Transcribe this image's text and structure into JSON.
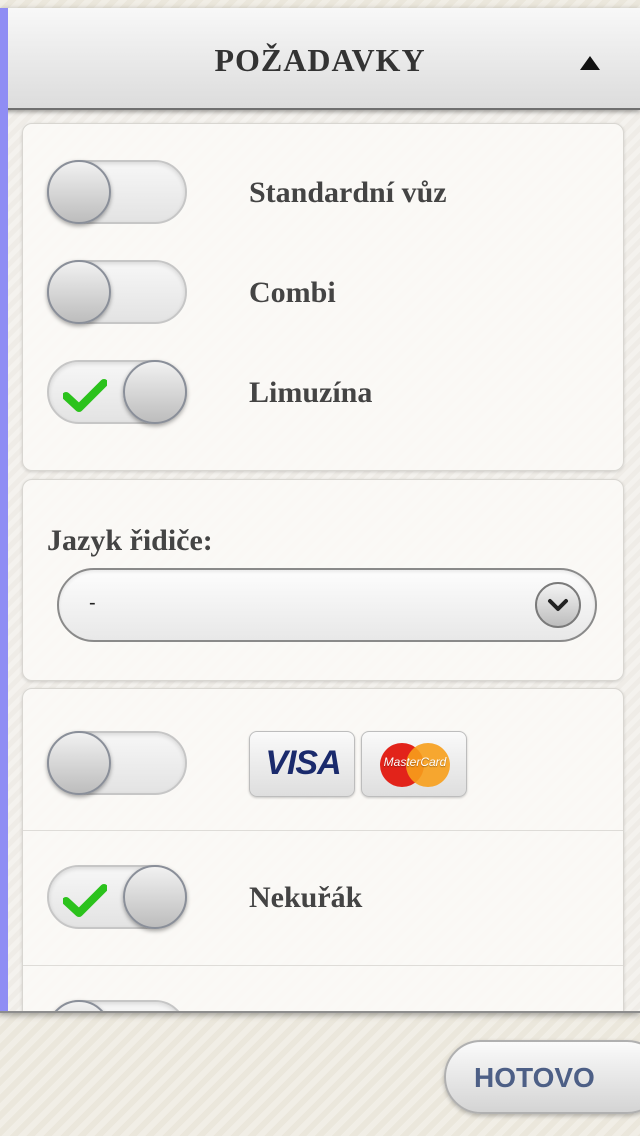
{
  "header": {
    "title": "POŽADAVKY",
    "collapse_icon": "triangle-up-icon"
  },
  "vehicle_types": [
    {
      "label": "Standardní vůz",
      "checked": false
    },
    {
      "label": "Combi",
      "checked": false
    },
    {
      "label": "Limuzína",
      "checked": true
    }
  ],
  "driver_language": {
    "label": "Jazyk řidiče:",
    "selected": "-",
    "dropdown_icon": "chevron-down-icon"
  },
  "options": {
    "card_payment": {
      "checked": false,
      "visa_label": "VISA",
      "mastercard_label": "MasterCard"
    },
    "non_smoker": {
      "label": "Nekuřák",
      "checked": true
    }
  },
  "footer": {
    "done_label": "HOTOVO"
  },
  "colors": {
    "accent": "#8f8df4",
    "check": "#2bc21c",
    "button_text": "#4d5f86"
  }
}
